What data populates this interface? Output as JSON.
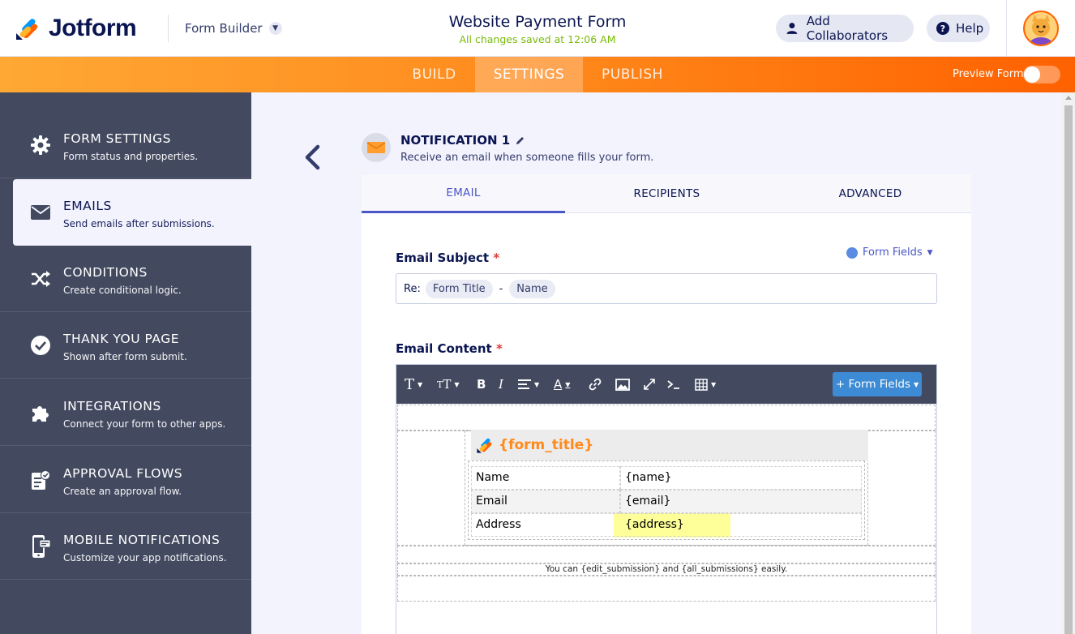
{
  "header": {
    "logo_text": "Jotform",
    "builder_label": "Form Builder",
    "form_title": "Website Payment Form",
    "save_status": "All changes saved at 12:06 AM",
    "add_collaborators": "Add Collaborators",
    "help": "Help"
  },
  "nav": {
    "tabs": [
      "BUILD",
      "SETTINGS",
      "PUBLISH"
    ],
    "active_tab": "SETTINGS",
    "preview_label": "Preview Form"
  },
  "sidebar": {
    "items": [
      {
        "title": "FORM SETTINGS",
        "subtitle": "Form status and properties.",
        "icon": "gear-icon"
      },
      {
        "title": "EMAILS",
        "subtitle": "Send emails after submissions.",
        "icon": "envelope-icon"
      },
      {
        "title": "CONDITIONS",
        "subtitle": "Create conditional logic.",
        "icon": "shuffle-icon"
      },
      {
        "title": "THANK YOU PAGE",
        "subtitle": "Shown after form submit.",
        "icon": "check-circle-icon"
      },
      {
        "title": "INTEGRATIONS",
        "subtitle": "Connect your form to other apps.",
        "icon": "puzzle-icon"
      },
      {
        "title": "APPROVAL FLOWS",
        "subtitle": "Create an approval flow.",
        "icon": "approval-icon"
      },
      {
        "title": "MOBILE NOTIFICATIONS",
        "subtitle": "Customize your app notifications.",
        "icon": "mobile-icon"
      }
    ],
    "active": "EMAILS"
  },
  "notification": {
    "title": "NOTIFICATION 1",
    "subtitle": "Receive an email when someone fills your form.",
    "tabs": [
      "EMAIL",
      "RECIPIENTS",
      "ADVANCED"
    ],
    "active_tab": "EMAIL"
  },
  "subject": {
    "label": "Email Subject",
    "required_mark": "*",
    "form_fields_link": "Form Fields",
    "prefix": "Re:",
    "chip1": "Form Title",
    "separator": "-",
    "chip2": "Name"
  },
  "content": {
    "label": "Email Content",
    "required_mark": "*",
    "form_fields_button": "+ Form Fields",
    "template_title": "{form_title}",
    "rows": [
      {
        "key": "Name",
        "value": "{name}"
      },
      {
        "key": "Email",
        "value": "{email}"
      },
      {
        "key": "Address",
        "value": "{address}"
      }
    ],
    "footer": "You can {edit_submission} and {all_submissions} easily."
  },
  "colors": {
    "accent": "#ff6100",
    "sidebar": "#434a60",
    "active_tab": "#4b57c7",
    "saved": "#78bb07",
    "highlight": "#ffff99"
  }
}
